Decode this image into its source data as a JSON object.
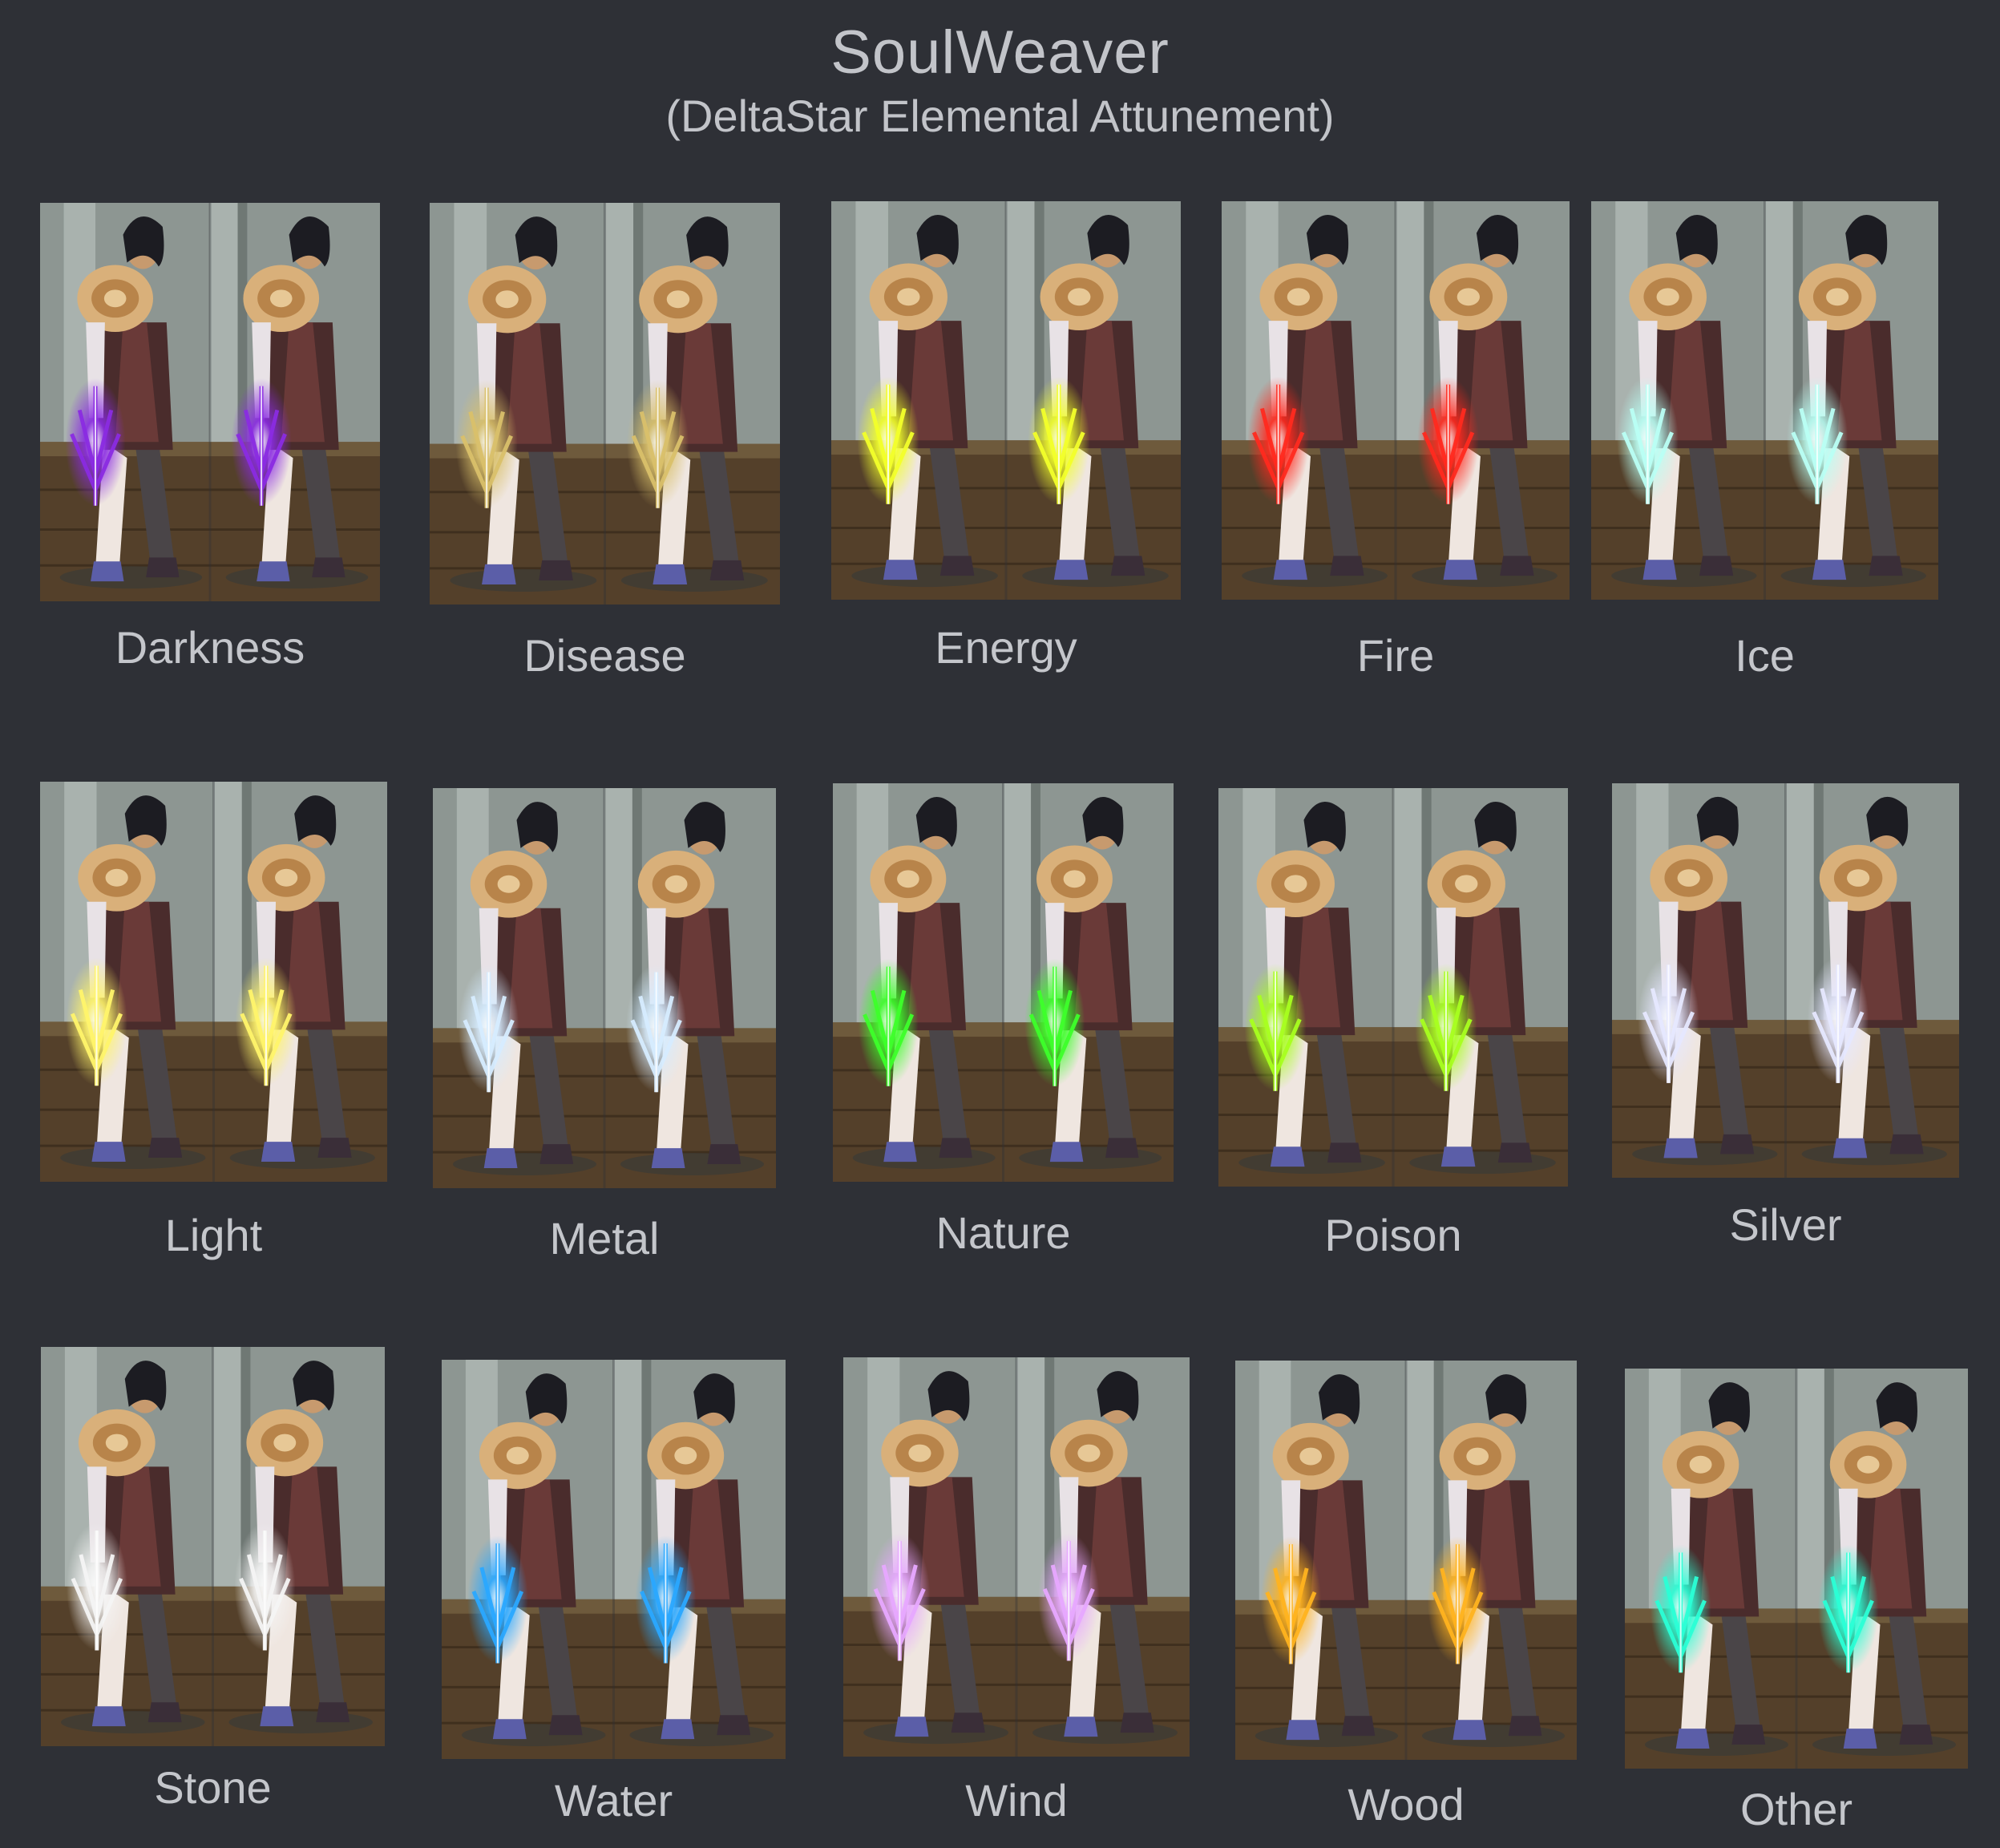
{
  "title": "SoulWeaver",
  "subtitle": "(DeltaStar Elemental Attunement)",
  "variants": [
    {
      "label": "Darkness",
      "glow": "#8a2be2"
    },
    {
      "label": "Disease",
      "glow": "#d9c06a"
    },
    {
      "label": "Energy",
      "glow": "#f2ff2a"
    },
    {
      "label": "Fire",
      "glow": "#ff2a1f"
    },
    {
      "label": "Ice",
      "glow": "#b9fff4"
    },
    {
      "label": "Light",
      "glow": "#fff46a"
    },
    {
      "label": "Metal",
      "glow": "#d6ecff"
    },
    {
      "label": "Nature",
      "glow": "#3dff2a"
    },
    {
      "label": "Poison",
      "glow": "#a8ff1f"
    },
    {
      "label": "Silver",
      "glow": "#e6e8ff"
    },
    {
      "label": "Stone",
      "glow": "#f4f4f4"
    },
    {
      "label": "Water",
      "glow": "#2aa8ff"
    },
    {
      "label": "Wind",
      "glow": "#e7a8ff"
    },
    {
      "label": "Wood",
      "glow": "#ffb31f"
    },
    {
      "label": "Other",
      "glow": "#2affd6"
    }
  ]
}
